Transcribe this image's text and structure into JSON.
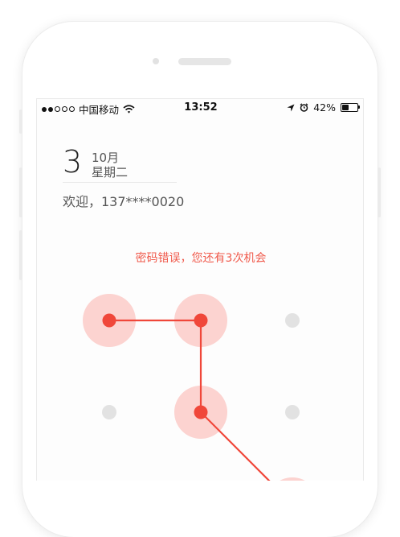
{
  "status_bar": {
    "carrier": "中国移动",
    "time": "13:52",
    "battery_percent": "42%",
    "battery_level": 0.42,
    "icons": [
      "signal-dots-icon",
      "wifi-icon",
      "location-arrow-icon",
      "alarm-icon",
      "battery-icon"
    ]
  },
  "date": {
    "day": "3",
    "month": "10月",
    "weekday": "星期二"
  },
  "welcome_text": "欢迎，137****0020",
  "error_message": "密码错误，您还有3次机会",
  "colors": {
    "accent": "#f0473a",
    "halo": "#fcd3d0",
    "inactive_dot": "#e2e2e2",
    "error_text": "#f05a4c"
  },
  "pattern": {
    "grid_columns": 3,
    "path": [
      1,
      2,
      5,
      9
    ],
    "active_nodes": [
      1,
      2,
      5,
      9
    ]
  }
}
